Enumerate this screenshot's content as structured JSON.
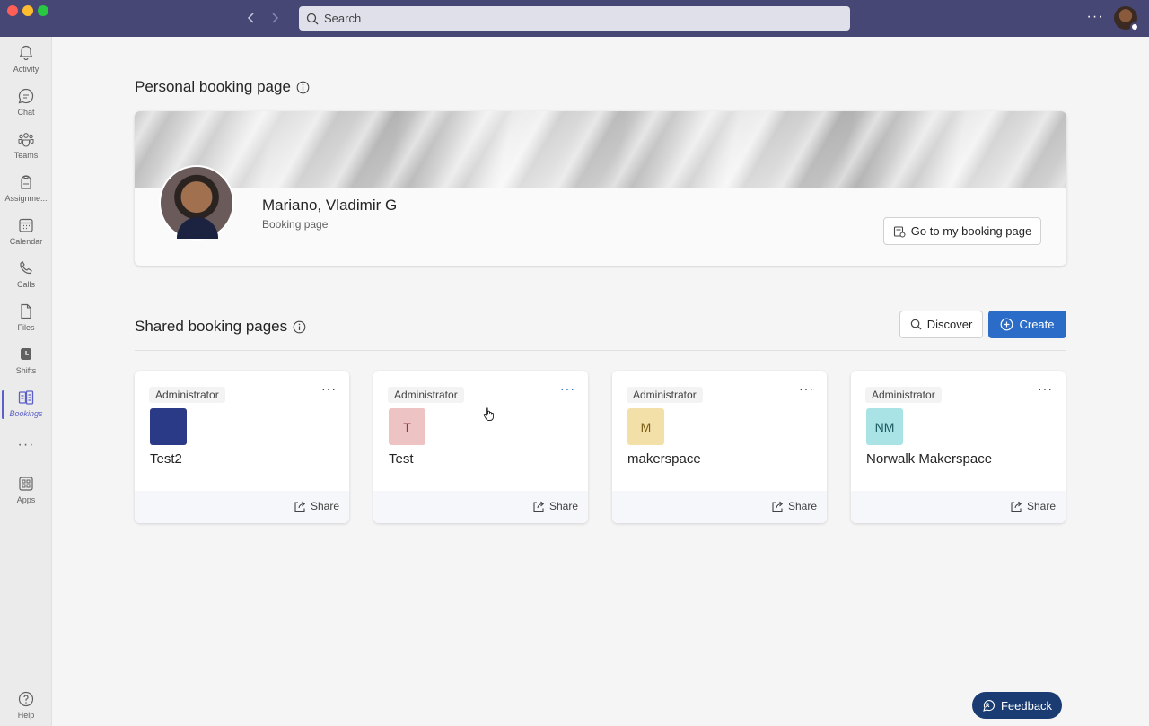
{
  "window": {
    "search_placeholder": "Search",
    "more_label": "···",
    "user_avatar": "user-avatar",
    "colors": {
      "titlebar": "#464775",
      "accent": "#2a6cc8",
      "feedback": "#1b3c72"
    }
  },
  "rail": {
    "items": [
      {
        "label": "Activity",
        "icon": "bell-icon"
      },
      {
        "label": "Chat",
        "icon": "chat-icon"
      },
      {
        "label": "Teams",
        "icon": "teams-icon"
      },
      {
        "label": "Assignme...",
        "icon": "backpack-icon"
      },
      {
        "label": "Calendar",
        "icon": "calendar-icon"
      },
      {
        "label": "Calls",
        "icon": "phone-icon"
      },
      {
        "label": "Files",
        "icon": "file-icon"
      },
      {
        "label": "Shifts",
        "icon": "shifts-icon"
      },
      {
        "label": "Bookings",
        "icon": "bookings-icon",
        "active": true
      },
      {
        "label": "Apps",
        "icon": "apps-icon"
      },
      {
        "label": "Help",
        "icon": "help-icon"
      }
    ],
    "more_label": "···"
  },
  "personal": {
    "section_title": "Personal booking page",
    "name": "Mariano, Vladimir G",
    "subtitle": "Booking page",
    "go_button": "Go to my booking page"
  },
  "shared": {
    "section_title": "Shared booking pages",
    "discover_button": "Discover",
    "create_button": "Create",
    "cards": [
      {
        "role": "Administrator",
        "initials": "",
        "name": "Test2",
        "tile_color": "#2b3a87",
        "text_color": "#ffffff",
        "share": "Share",
        "more": "···"
      },
      {
        "role": "Administrator",
        "initials": "T",
        "name": "Test",
        "tile_color": "#eec3c4",
        "text_color": "#8a3a3e",
        "share": "Share",
        "more": "···"
      },
      {
        "role": "Administrator",
        "initials": "M",
        "name": "makerspace",
        "tile_color": "#f3dfa8",
        "text_color": "#7a5a14",
        "share": "Share",
        "more": "···"
      },
      {
        "role": "Administrator",
        "initials": "NM",
        "name": "Norwalk Makerspace",
        "tile_color": "#a9e3e6",
        "text_color": "#17585c",
        "share": "Share",
        "more": "···"
      }
    ]
  },
  "feedback_button": "Feedback"
}
